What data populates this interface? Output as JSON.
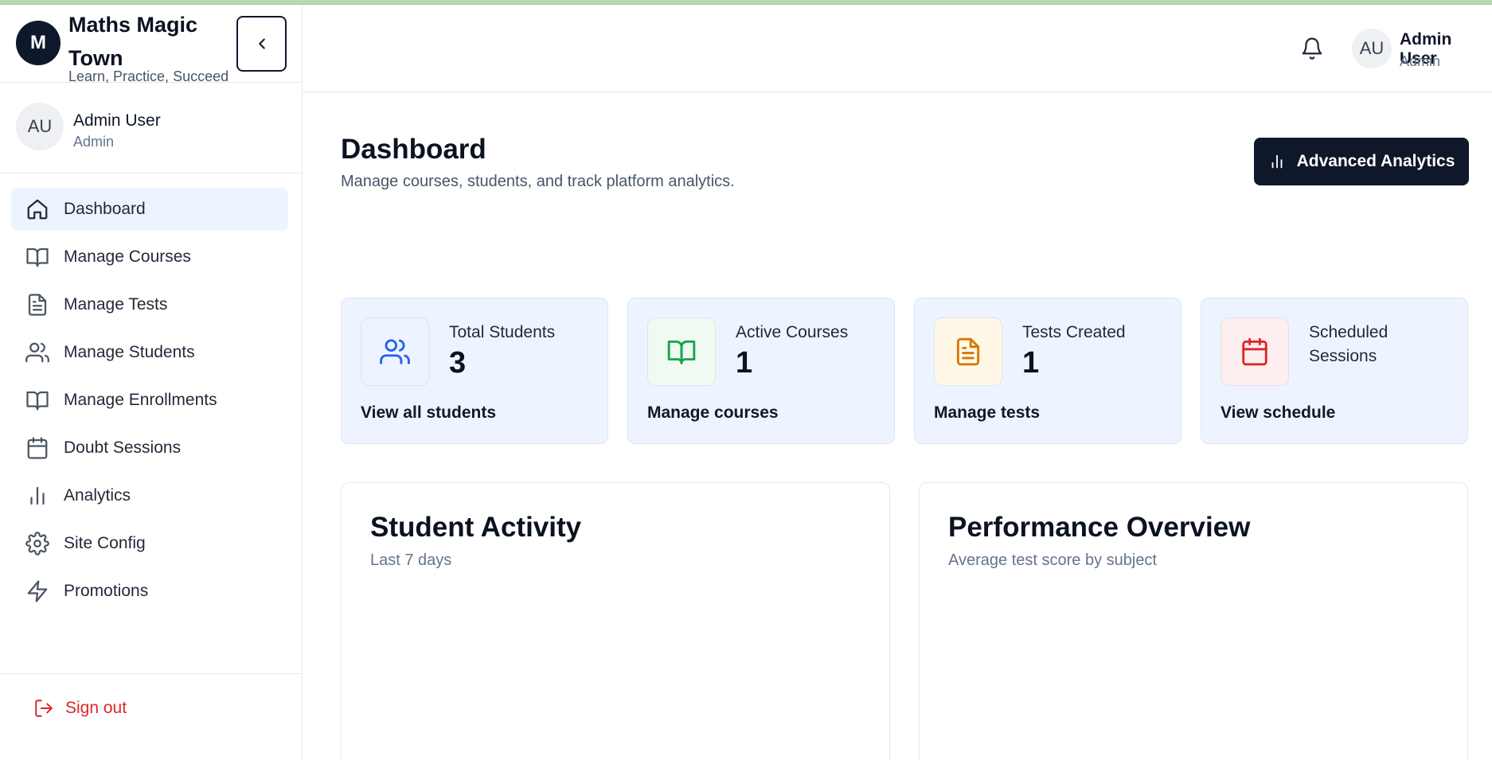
{
  "brand": {
    "logo_letter": "M",
    "name": "Maths Magic Town",
    "tagline": "Learn, Practice, Succeed"
  },
  "sidebar_user": {
    "initials": "AU",
    "name": "Admin User",
    "role": "Admin"
  },
  "nav": {
    "items": [
      {
        "label": "Dashboard",
        "icon": "home-icon",
        "active": true
      },
      {
        "label": "Manage Courses",
        "icon": "book-icon"
      },
      {
        "label": "Manage Tests",
        "icon": "file-text-icon"
      },
      {
        "label": "Manage Students",
        "icon": "users-icon"
      },
      {
        "label": "Manage Enrollments",
        "icon": "book-icon"
      },
      {
        "label": "Doubt Sessions",
        "icon": "calendar-icon"
      },
      {
        "label": "Analytics",
        "icon": "bar-chart-icon"
      },
      {
        "label": "Site Config",
        "icon": "gear-icon"
      },
      {
        "label": "Promotions",
        "icon": "zap-icon"
      }
    ]
  },
  "signout": {
    "label": "Sign out"
  },
  "header": {
    "initials": "AU",
    "name": "Admin User",
    "role": "Admin"
  },
  "page": {
    "title": "Dashboard",
    "subtitle": "Manage courses, students, and track platform analytics.",
    "analytics_button": "Advanced Analytics"
  },
  "stats": [
    {
      "label": "Total Students",
      "value": "3",
      "link": "View all students",
      "icon": "users-icon",
      "accent": "#2563eb",
      "icon_bg": "#eef4ff"
    },
    {
      "label": "Active Courses",
      "value": "1",
      "link": "Manage courses",
      "icon": "book-icon",
      "accent": "#16a34a",
      "icon_bg": "#effbf2"
    },
    {
      "label": "Tests Created",
      "value": "1",
      "link": "Manage tests",
      "icon": "file-text-icon",
      "accent": "#d97706",
      "icon_bg": "#fff8e6"
    },
    {
      "label": "Scheduled Sessions",
      "value": "",
      "link": "View schedule",
      "icon": "calendar-icon",
      "accent": "#dc2626",
      "icon_bg": "#fdeef0"
    }
  ],
  "panels": [
    {
      "title": "Student Activity",
      "subtitle": "Last 7 days"
    },
    {
      "title": "Performance Overview",
      "subtitle": "Average test score by subject"
    }
  ]
}
